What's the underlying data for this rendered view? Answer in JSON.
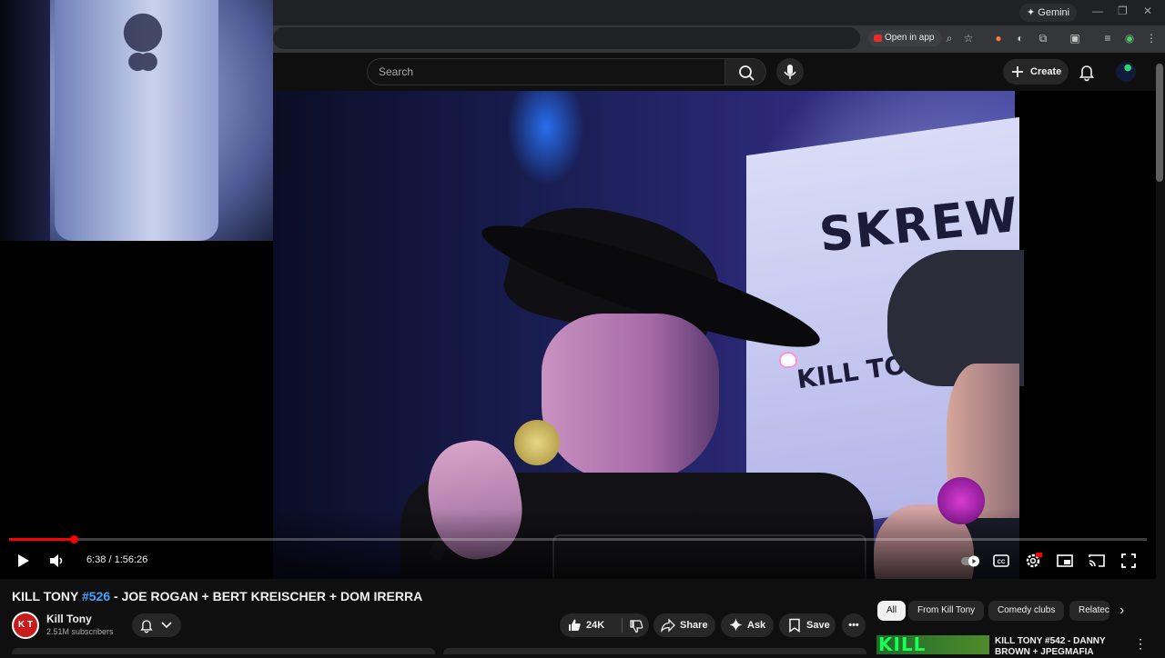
{
  "browser": {
    "gemini_label": "Gemini",
    "open_in_app_label": "Open in app"
  },
  "masthead": {
    "search_placeholder": "Search",
    "create_label": "Create"
  },
  "player": {
    "current_time": "6:38",
    "duration": "1:56:26",
    "time_display": "6:38 / 1:56:26",
    "progress_fraction": 0.057,
    "banner_text": "SKREW",
    "banner_kill_tony": "KILL TONY"
  },
  "video": {
    "title_prefix": "KILL TONY ",
    "title_hashtag": "#526",
    "title_suffix": " - JOE ROGAN + BERT KREISCHER + DOM IRERRA"
  },
  "channel": {
    "avatar_text": "K T",
    "name": "Kill Tony",
    "subscribers": "2.51M subscribers"
  },
  "actions": {
    "like_count": "24K",
    "share_label": "Share",
    "ask_label": "Ask",
    "save_label": "Save"
  },
  "chips": [
    "All",
    "From Kill Tony",
    "Comedy clubs",
    "Relatec"
  ],
  "recommendation": {
    "thumb_text": "KILL TONY",
    "title": "KILL TONY #542 - DANNY BROWN + JPEGMAFIA"
  },
  "colors": {
    "accent_red": "#ff0000",
    "link_blue": "#3ea6ff",
    "background": "#0f0f0f"
  }
}
